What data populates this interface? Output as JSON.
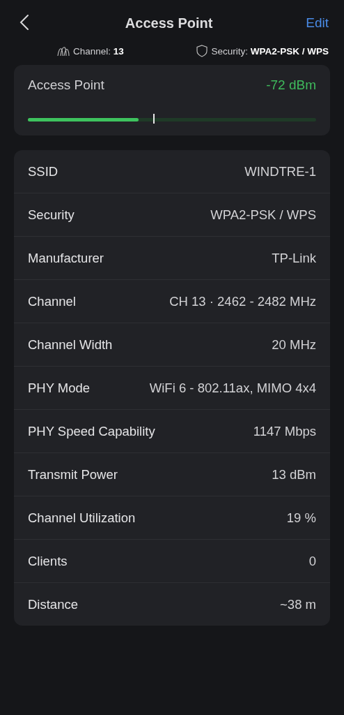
{
  "header": {
    "title": "Access Point",
    "action": "Edit"
  },
  "summary": {
    "channel_label": "Channel:",
    "channel": "13",
    "security_label": "Security:",
    "security": "WPA2-PSK / WPS"
  },
  "signal": {
    "title": "Access Point",
    "reading": "-72 dBm",
    "level": 0.385,
    "marker": {
      "level": 0.435
    }
  },
  "details": [
    {
      "label": "SSID",
      "value": "WINDTRE-1"
    },
    {
      "label": "Security",
      "value": "WPA2-PSK / WPS"
    },
    {
      "label": "Manufacturer",
      "value": "TP-Link"
    },
    {
      "label": "Channel",
      "value": "CH 13 · 2462 - 2482 MHz"
    },
    {
      "label": "Channel Width",
      "value": "20 MHz"
    },
    {
      "label": "PHY Mode",
      "value": "WiFi 6 - 802.11ax, MIMO 4x4"
    },
    {
      "label": "PHY Speed Capability",
      "value": "1147 Mbps"
    },
    {
      "label": "Transmit Power",
      "value": "13 dBm"
    },
    {
      "label": "Channel Utilization",
      "value": "19 %"
    },
    {
      "label": "Clients",
      "value": "0"
    },
    {
      "label": "Distance",
      "value": "~38 m"
    }
  ]
}
